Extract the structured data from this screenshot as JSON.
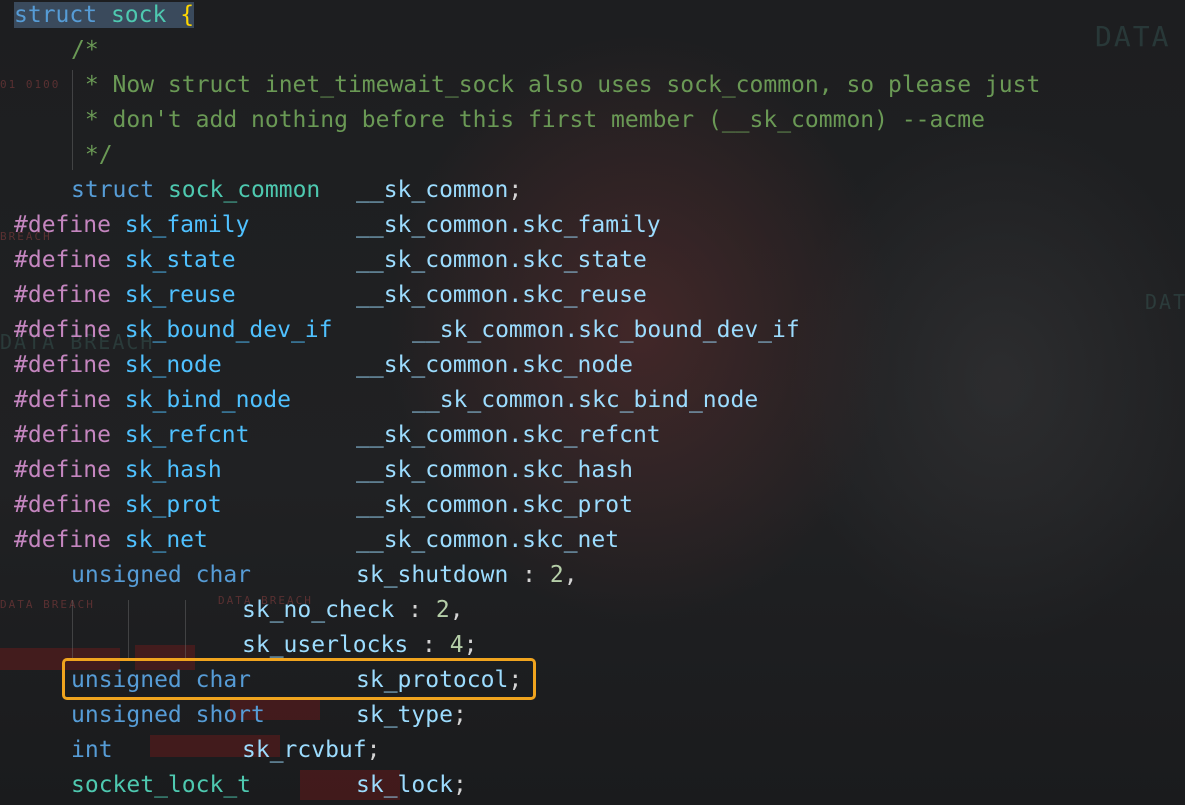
{
  "code": {
    "struct_open": {
      "kw": "struct",
      "name": "sock",
      "brace": "{"
    },
    "comment": [
      "/*",
      " * Now struct inet_timewait_sock also uses sock_common, so please just",
      " * don't add nothing before this first member (__sk_common) --acme",
      " */"
    ],
    "member_common": {
      "kw": "struct",
      "type": "sock_common",
      "name": "__sk_common",
      "punct": ";"
    },
    "defines": [
      {
        "directive": "#define",
        "name": "sk_family",
        "value": "__sk_common.skc_family"
      },
      {
        "directive": "#define",
        "name": "sk_state",
        "value": "__sk_common.skc_state"
      },
      {
        "directive": "#define",
        "name": "sk_reuse",
        "value": "__sk_common.skc_reuse"
      },
      {
        "directive": "#define",
        "name": "sk_bound_dev_if",
        "value": "__sk_common.skc_bound_dev_if"
      },
      {
        "directive": "#define",
        "name": "sk_node",
        "value": "__sk_common.skc_node"
      },
      {
        "directive": "#define",
        "name": "sk_bind_node",
        "value": "__sk_common.skc_bind_node"
      },
      {
        "directive": "#define",
        "name": "sk_refcnt",
        "value": "__sk_common.skc_refcnt"
      },
      {
        "directive": "#define",
        "name": "sk_hash",
        "value": "__sk_common.skc_hash"
      },
      {
        "directive": "#define",
        "name": "sk_prot",
        "value": "__sk_common.skc_prot"
      },
      {
        "directive": "#define",
        "name": "sk_net",
        "value": "__sk_common.skc_net"
      }
    ],
    "bitfields": {
      "type": "unsigned char",
      "fields": [
        {
          "name": "sk_shutdown",
          "sep": " : ",
          "bits": "2",
          "punct": ","
        },
        {
          "name": "sk_no_check",
          "sep": " : ",
          "bits": "2",
          "punct": ","
        },
        {
          "name": "sk_userlocks",
          "sep": " : ",
          "bits": "4",
          "punct": ";"
        }
      ]
    },
    "members": [
      {
        "type": "unsigned char",
        "name": "sk_protocol",
        "punct": ";",
        "highlighted": true
      },
      {
        "type": "unsigned short",
        "name": "sk_type",
        "punct": ";"
      },
      {
        "type": "int",
        "name": "sk_rcvbuf",
        "punct": ";"
      },
      {
        "type": "socket_lock_t",
        "name": "sk_lock",
        "punct": ";"
      }
    ]
  },
  "background_text": {
    "top_right": "DATA",
    "mid_right": "DAT",
    "left_mid": "DATA BREACH",
    "left_small_1": "BREACH",
    "left_small_2": "DATA BREACH",
    "left_small_3": "DATA BREACH",
    "left_top": "01 0100"
  },
  "colors": {
    "keyword": "#569cd6",
    "type": "#4ec9b0",
    "macro": "#c586c0",
    "member": "#9cdcfe",
    "comment": "#6a9955",
    "number": "#b5cea8",
    "highlight_box": "#f0a41e"
  }
}
